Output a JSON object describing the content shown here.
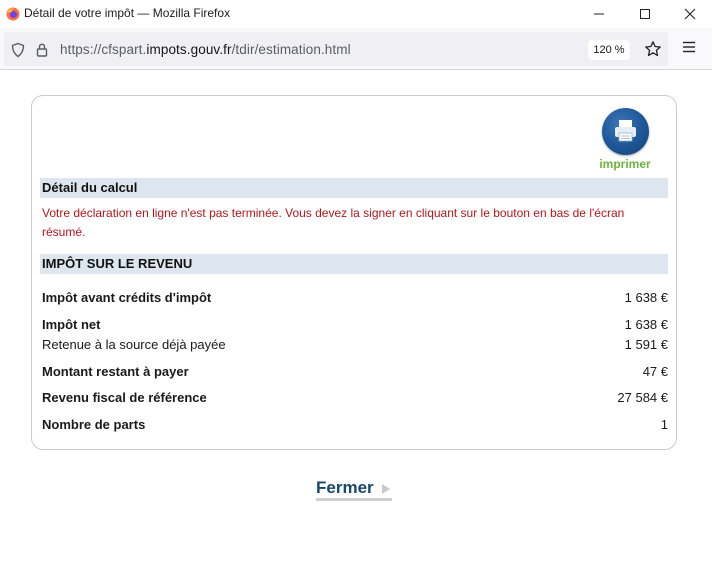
{
  "window": {
    "title": "Détail de votre impôt — Mozilla Firefox"
  },
  "navbar": {
    "url_prefix": "https://cfspart.",
    "url_host": "impots.gouv.fr",
    "url_path": "/tdir/estimation.html",
    "zoom": "120 %"
  },
  "page": {
    "print_label": "imprimer",
    "section_detail": "Détail du calcul",
    "warning": "Votre déclaration en ligne n'est pas terminée. Vous devez la signer en cliquant sur le bouton en bas de l'écran résumé.",
    "section_income_tax": "IMPÔT SUR LE REVENU",
    "rows": [
      {
        "label": "Impôt avant crédits d'impôt",
        "value": "1 638 €"
      },
      {
        "label": "Impôt net",
        "value": "1 638 €"
      },
      {
        "label": "Retenue à la source déjà payée",
        "value": "1 591 €"
      },
      {
        "label": "Montant restant à payer",
        "value": "47 €"
      },
      {
        "label": "Revenu fiscal de référence",
        "value": "27 584 €"
      },
      {
        "label": "Nombre de parts",
        "value": "1"
      }
    ],
    "close_label": "Fermer"
  },
  "colors": {
    "warning_text": "#b5161b",
    "section_background": "#dde6ee",
    "print_label": "#6bb33c",
    "close_link": "#17476e"
  },
  "icons": [
    "firefox-icon",
    "minimize-icon",
    "maximize-icon",
    "close-icon",
    "shield-icon",
    "lock-icon",
    "star-icon",
    "menu-icon",
    "printer-icon",
    "arrow-right-icon"
  ]
}
